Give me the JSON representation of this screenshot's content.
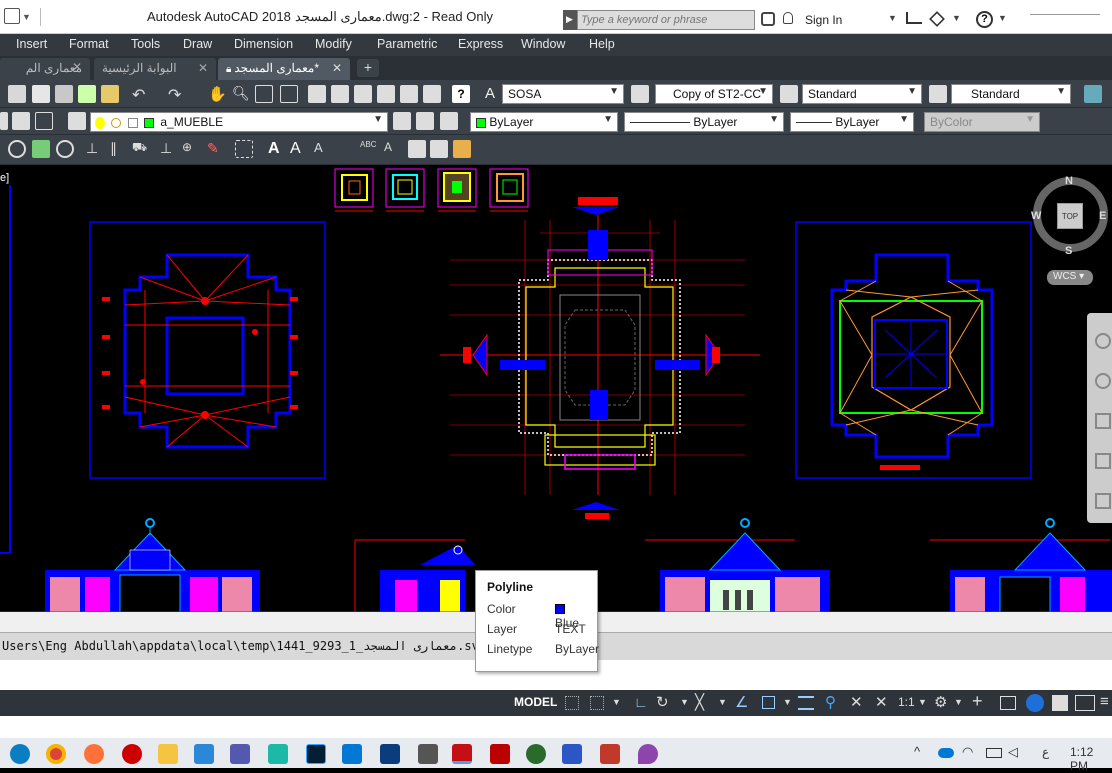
{
  "window": {
    "title": "Autodesk AutoCAD 2018",
    "filename": "معمارى المسجد.dwg:2 - Read Only",
    "search_placeholder": "Type a keyword or phrase",
    "sign_in": "Sign In"
  },
  "menu": [
    "Insert",
    "Format",
    "Tools",
    "Draw",
    "Dimension",
    "Modify",
    "Parametric",
    "Express",
    "Window",
    "Help"
  ],
  "tabs": [
    {
      "label": "معمارى الم"
    },
    {
      "label": "البوابة الرئيسية"
    },
    {
      "label": "معمارى المسجد*"
    }
  ],
  "toolbar": {
    "text_style": "SOSA",
    "dim_style": "Copy of ST2-CC",
    "table_style": "Standard",
    "mleader_style": "Standard",
    "layer": "a_MUEBLE",
    "color": "ByLayer",
    "linetype": "ByLayer",
    "lineweight": "ByLayer",
    "plotstyle": "ByColor"
  },
  "viewcube": {
    "north": "N",
    "south": "S",
    "east": "E",
    "west": "W",
    "top": "TOP",
    "wcs": "WCS"
  },
  "canvas": {
    "left_label": "e]"
  },
  "tooltip": {
    "title": "Polyline",
    "color_label": "Color",
    "color_value": "Blue",
    "layer_label": "Layer",
    "layer_value": "TEXT",
    "linetype_label": "Linetype",
    "linetype_value": "ByLayer"
  },
  "command_line": {
    "text": "Users\\Eng Abdullah\\appdata\\local\\temp\\1441_9293_1_معمارى المسجد.sv$"
  },
  "statusbar": {
    "model": "MODEL",
    "scale": "1:1"
  },
  "taskbar": {
    "time": "1:12 PM",
    "lang": "ع"
  },
  "colors": {
    "accent_blue": "#0000ff",
    "drawing_red": "#ff0000",
    "drawing_yellow": "#ffff00"
  }
}
